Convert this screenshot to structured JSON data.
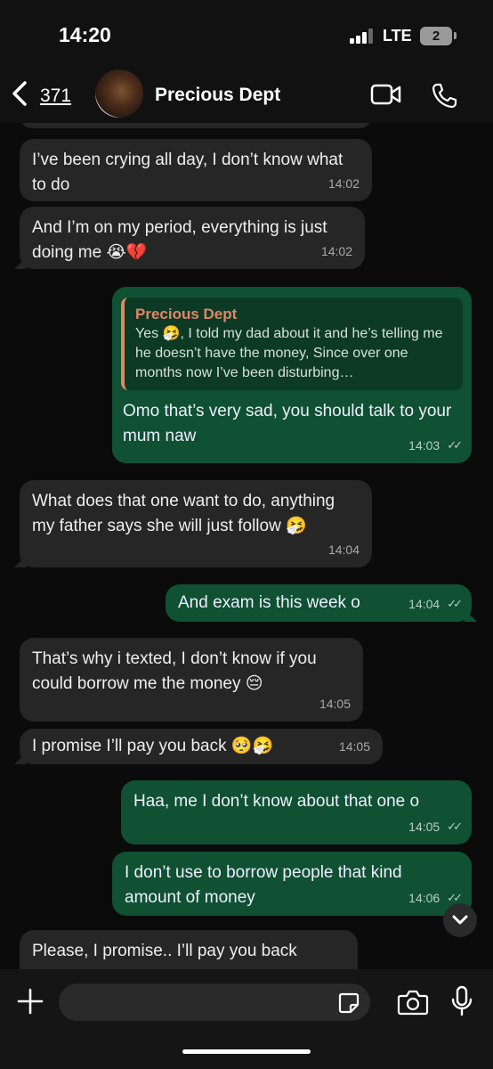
{
  "status": {
    "time": "14:20",
    "network": "LTE",
    "battery": "2"
  },
  "header": {
    "back_count": "371",
    "contact_name": "Precious Dept"
  },
  "messages": [
    {
      "dir": "in",
      "text": "I’ve been crying all day, I don’t know what to do",
      "time": "14:02"
    },
    {
      "dir": "in",
      "text": "And I’m on my period, everything is just doing me 😭💔",
      "time": "14:02"
    },
    {
      "dir": "out",
      "quote_name": "Precious Dept",
      "quote_text": "Yes 🤧, I told my dad about it and he’s telling me he doesn’t have the money, Since over one months now I’ve been disturbing…",
      "text": "Omo that’s very sad, you should talk to your mum naw",
      "time": "14:03"
    },
    {
      "dir": "in",
      "text": "What does that one want to do, anything my father says she will just follow 🤧",
      "time": "14:04"
    },
    {
      "dir": "out",
      "text": "And exam is this week o",
      "time": "14:04"
    },
    {
      "dir": "in",
      "text": "That’s why i texted, I don’t know if you could borrow me the money 😔",
      "time": "14:05"
    },
    {
      "dir": "in",
      "text": "I promise I’ll pay you back 🥺🤧",
      "time": "14:05"
    },
    {
      "dir": "out",
      "text": "Haa, me I don’t know about that one o",
      "time": "14:05"
    },
    {
      "dir": "out",
      "text": "I don’t use to borrow people that kind amount of money",
      "time": "14:06"
    },
    {
      "dir": "in",
      "text": "Please, I promise.. I’ll pay you back",
      "time": ""
    }
  ],
  "input": {
    "placeholder": ""
  },
  "icons": [
    "back-chevron-icon",
    "video-call-icon",
    "phone-icon",
    "plus-icon",
    "sticker-icon",
    "camera-icon",
    "microphone-icon",
    "chevron-down-icon"
  ],
  "colors": {
    "incoming_bubble": "#262626",
    "outgoing_bubble": "#0f5132",
    "quote_accent": "#e0876a"
  }
}
